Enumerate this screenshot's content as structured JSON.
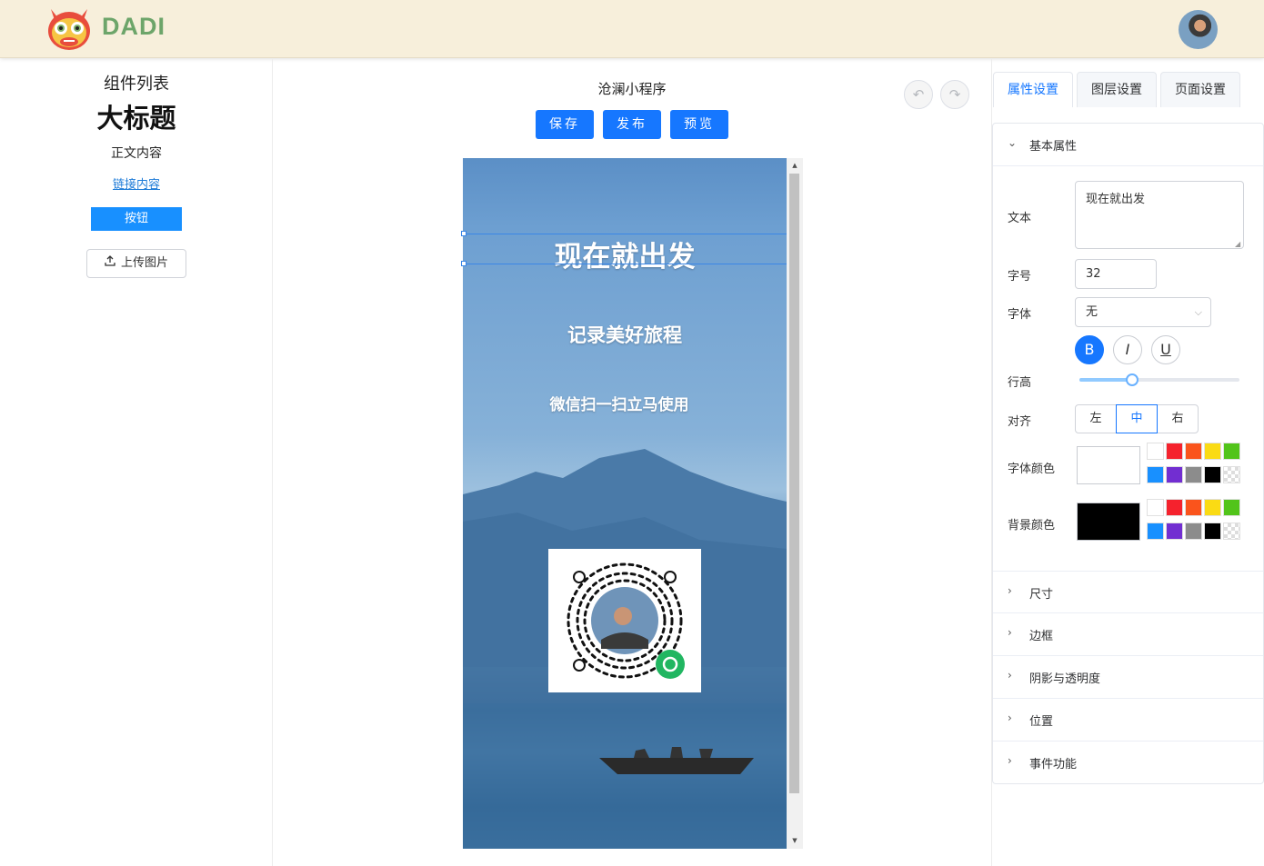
{
  "header": {
    "brand": "DADI",
    "logo_icon": "dragon-mascot-icon",
    "avatar_icon": "user-avatar-icon"
  },
  "components": {
    "title": "组件列表",
    "heading": "大标题",
    "body_text": "正文内容",
    "link_text": "链接内容",
    "button_text": "按钮",
    "upload_text": "上传图片",
    "upload_icon": "upload-icon"
  },
  "canvas": {
    "app_name": "沧澜小程序",
    "save_label": "保存",
    "publish_label": "发布",
    "preview_label": "预览",
    "undo_icon": "undo-icon",
    "redo_icon": "redo-icon",
    "text1": "现在就出发",
    "text2": "记录美好旅程",
    "text3": "微信扫一扫立马使用",
    "qr_icon": "miniprogram-qrcode-icon",
    "background": "lake-mountain-photo"
  },
  "tabs": [
    {
      "label": "属性设置"
    },
    {
      "label": "图层设置"
    },
    {
      "label": "页面设置"
    }
  ],
  "props": {
    "basic_section": "基本属性",
    "text_label": "文本",
    "text_value": "现在就出发",
    "size_label": "字号",
    "size_value": "32",
    "font_label": "字体",
    "font_value": "无",
    "bold": "B",
    "italic": "I",
    "underline": "U",
    "line_height_label": "行高",
    "line_height_level": 0.33,
    "align_label": "对齐",
    "align_left": "左",
    "align_center": "中",
    "align_right": "右",
    "align_selected": "中",
    "font_color_label": "字体颜色",
    "font_color": "#ffffff",
    "bg_color_label": "背景颜色",
    "bg_color": "#000000",
    "palette": [
      "#ffffff",
      "#f5222d",
      "#fa541c",
      "#fadb14",
      "#52c41a",
      "#1890ff",
      "#722ed1",
      "#8c8c8c",
      "#000000",
      "transparent"
    ]
  },
  "sections": [
    {
      "label": "尺寸"
    },
    {
      "label": "边框"
    },
    {
      "label": "阴影与透明度"
    },
    {
      "label": "位置"
    },
    {
      "label": "事件功能"
    }
  ]
}
